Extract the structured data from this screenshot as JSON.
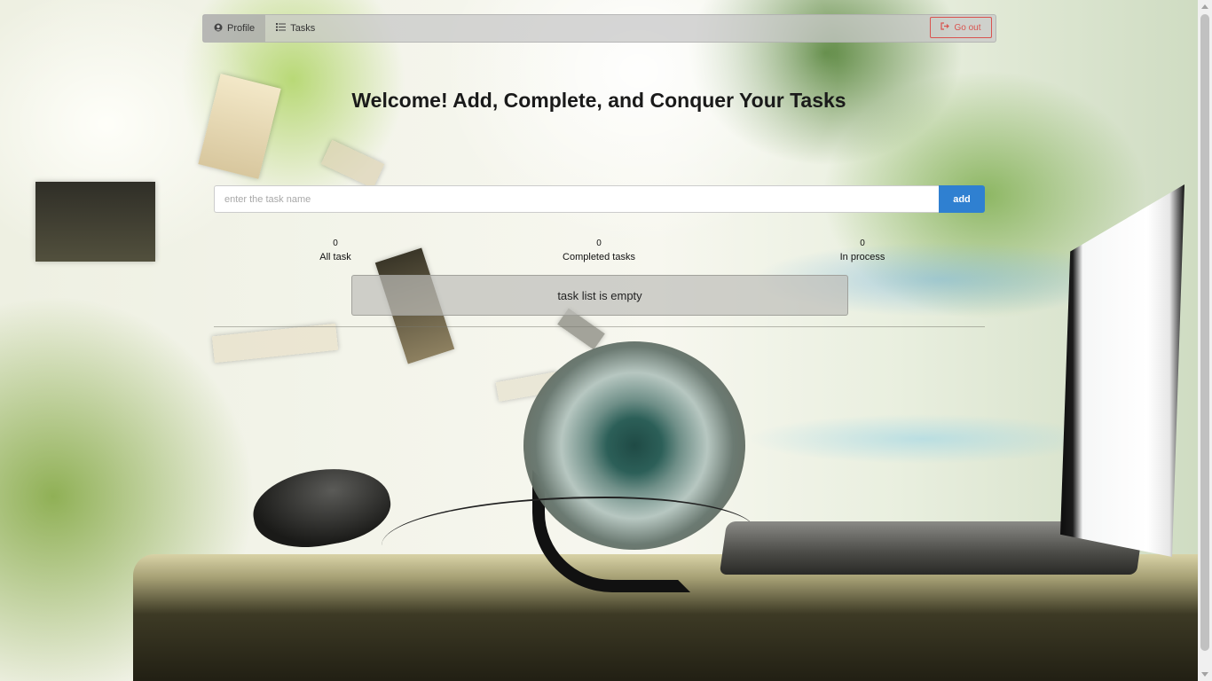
{
  "nav": {
    "profile_label": "Profile",
    "tasks_label": "Tasks",
    "goout_label": "Go out",
    "icons": {
      "profile": "user-circle-icon",
      "tasks": "list-icon",
      "goout": "sign-out-icon"
    }
  },
  "page": {
    "title": "Welcome! Add, Complete, and Conquer Your Tasks"
  },
  "task_form": {
    "input_value": "",
    "placeholder": "enter the task name",
    "add_label": "add"
  },
  "stats": [
    {
      "value": "0",
      "label": "All task"
    },
    {
      "value": "0",
      "label": "Completed tasks"
    },
    {
      "value": "0",
      "label": "In process"
    }
  ],
  "task_list": {
    "empty_text": "task list is empty"
  },
  "colors": {
    "accent": "#2f80d1",
    "danger": "#d9534f"
  }
}
